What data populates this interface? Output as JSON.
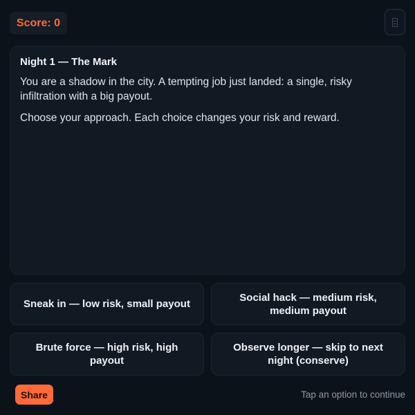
{
  "header": {
    "score_label": "Score: 0",
    "menu_icon": "menu-icon"
  },
  "story": {
    "title": "Night 1 — The Mark",
    "paragraphs": [
      "You are a shadow in the city. A tempting job just landed: a single, risky infiltration with a big payout.",
      "Choose your approach. Each choice changes your risk and reward."
    ]
  },
  "choices": [
    {
      "label": "Sneak in — low risk, small payout"
    },
    {
      "label": "Social hack — medium risk, medium payout"
    },
    {
      "label": "Brute force — high risk, high payout"
    },
    {
      "label": "Observe longer — skip to next night (conserve)"
    }
  ],
  "footer": {
    "share_label": "Share",
    "hint": "Tap an option to continue"
  },
  "colors": {
    "background": "#0c121a",
    "panel": "#111923",
    "accent": "#ff6a3a",
    "text": "#e6ebf1",
    "muted": "#8f99a6"
  }
}
